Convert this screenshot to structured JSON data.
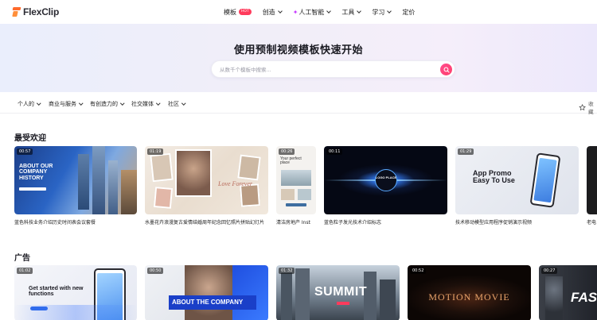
{
  "app": {
    "logo_text": "FlexClip"
  },
  "nav": {
    "items": [
      {
        "label": "模板",
        "badge": "HOT"
      },
      {
        "label": "创造"
      },
      {
        "label": "人工智能"
      },
      {
        "label": "工具"
      },
      {
        "label": "学习"
      },
      {
        "label": "定价"
      }
    ]
  },
  "hero": {
    "title": "使用预制视频模板快速开始",
    "search_placeholder": "从数千个模板中搜索..."
  },
  "categories": {
    "items": [
      "个人的",
      "商业与服务",
      "有创造力的",
      "社交媒体",
      "社区"
    ],
    "favorites_label": "收藏"
  },
  "sections": {
    "popular": {
      "title": "最受欢迎",
      "cards": [
        {
          "duration": "00:57",
          "label": "蓝色科技业务介绍历史时间表会议套餐",
          "thumb_text": "ABOUT OUR COMPANY HISTORY"
        },
        {
          "duration": "01:19",
          "label": "水墨花卉浪漫复古爱情结婚周年纪念回忆照片拼贴幻灯片",
          "thumb_text": "Love Forever"
        },
        {
          "duration": "00:26",
          "label": "清洁房地产 Inst",
          "thumb_text": "Your perfect place"
        },
        {
          "duration": "00:11",
          "label": "蓝色粒子发光技术介绍标志",
          "thumb_text": "LOGO PLACE"
        },
        {
          "duration": "01:29",
          "label": "技术移动模型应用程序促销演示视频",
          "thumb_text": "App Promo Easy To Use"
        },
        {
          "duration": "",
          "label": "老电",
          "thumb_text": ""
        }
      ]
    },
    "ads": {
      "title": "广告",
      "cards": [
        {
          "duration": "01:02",
          "thumb_text": "Get started with new functions"
        },
        {
          "duration": "00:50",
          "thumb_text": "ABOUT THE COMPANY"
        },
        {
          "duration": "01:32",
          "thumb_text": "SUMMIT"
        },
        {
          "duration": "00:52",
          "thumb_text": "MOTION MOVIE"
        },
        {
          "duration": "00:27",
          "thumb_text": "FAS"
        }
      ]
    }
  },
  "colors": {
    "accent": "#ff3f6c",
    "logo": "#ff6b2c",
    "ai": "#c73bff"
  }
}
